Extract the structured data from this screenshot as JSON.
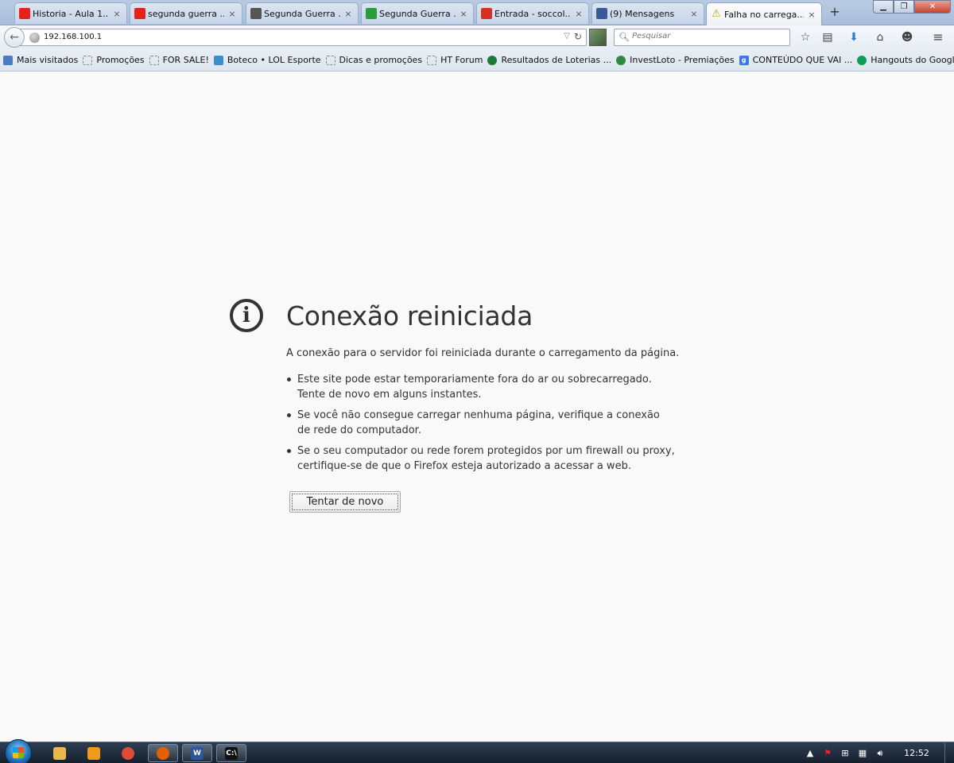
{
  "tabs": [
    {
      "label": "Historia - Aula 1...",
      "icon": "youtube-icon",
      "color": "#e62117"
    },
    {
      "label": "segunda guerra ...",
      "icon": "youtube-icon",
      "color": "#e62117"
    },
    {
      "label": "Segunda Guerra ...",
      "icon": "yo-icon",
      "color": "#555555"
    },
    {
      "label": "Segunda Guerra ...",
      "icon": "brazil-icon",
      "color": "#2a9d3b"
    },
    {
      "label": "Entrada - soccol...",
      "icon": "gmail-icon",
      "color": "#d93025"
    },
    {
      "label": "(9) Mensagens",
      "icon": "facebook-icon",
      "color": "#3b5998"
    },
    {
      "label": "Falha no carrega...",
      "icon": "warning-icon",
      "color": "#f2c200"
    }
  ],
  "tab_close_glyph": "×",
  "new_tab_glyph": "+",
  "navbar": {
    "url": "192.168.100.1",
    "search_placeholder": "Pesquisar"
  },
  "bookmarks": [
    {
      "label": "Mais visitados",
      "icon": "most-visited-icon",
      "color": "#4a7cc1"
    },
    {
      "label": "Promoções",
      "icon": "folder-icon",
      "color": "#888888"
    },
    {
      "label": "FOR SALE!",
      "icon": "folder-icon",
      "color": "#888888"
    },
    {
      "label": "Boteco • LOL Esporte",
      "icon": "forum-icon",
      "color": "#3a8fd1"
    },
    {
      "label": "Dicas e promoções",
      "icon": "folder-icon",
      "color": "#888888"
    },
    {
      "label": "HT Forum",
      "icon": "folder-icon",
      "color": "#888888"
    },
    {
      "label": "Resultados de Loterias ...",
      "icon": "lottery-icon",
      "color": "#1f7a3a"
    },
    {
      "label": "InvestLoto - Premiações",
      "icon": "clover-icon",
      "color": "#2e8b3e"
    },
    {
      "label": "CONTEÚDO QUE VAI ...",
      "icon": "google-icon",
      "color": "#3b78e7"
    },
    {
      "label": "Hangouts do Google+",
      "icon": "hangouts-icon",
      "color": "#0f9d58"
    }
  ],
  "error": {
    "title": "Conexão reiniciada",
    "description": "A conexão para o servidor foi reiniciada durante o carregamento da página.",
    "bullets": [
      "Este site pode estar temporariamente fora do ar ou sobrecarregado. Tente de novo em alguns instantes.",
      "Se você não consegue carregar nenhuma página, verifique a conexão de rede do computador.",
      "Se o seu computador ou rede forem protegidos por um firewall ou proxy, certifique-se de que o Firefox esteja autorizado a acessar a web."
    ],
    "retry_label": "Tentar de novo"
  },
  "taskbar": {
    "apps": [
      {
        "icon": "file-explorer-icon",
        "color": "#e8b84a",
        "open": false
      },
      {
        "icon": "media-player-icon",
        "color": "#f09a1c",
        "open": false
      },
      {
        "icon": "chrome-icon",
        "color": "#dd4b39",
        "open": false
      },
      {
        "icon": "firefox-icon",
        "color": "#e66000",
        "open": true
      },
      {
        "icon": "word-icon",
        "color": "#2b579a",
        "open": true,
        "glyph": "W"
      },
      {
        "icon": "command-prompt-icon",
        "color": "#111111",
        "open": true,
        "glyph": "C:\\"
      }
    ],
    "clock": "12:52"
  }
}
